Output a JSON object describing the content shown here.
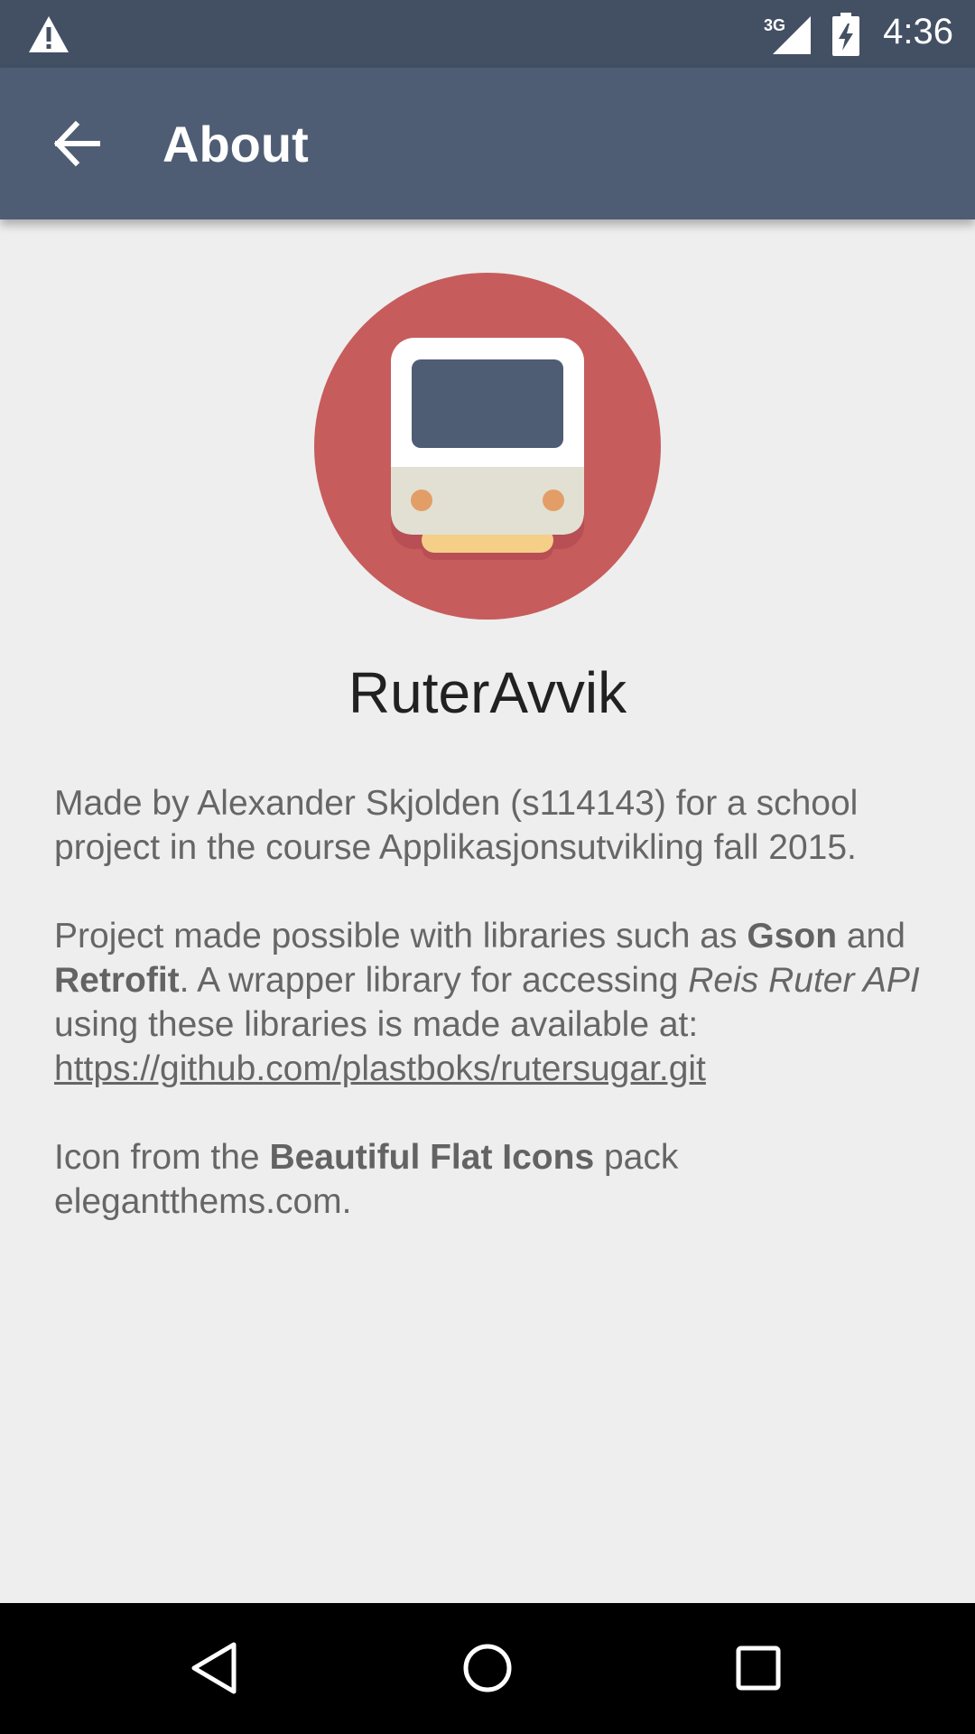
{
  "status_bar": {
    "network": "3G",
    "time": "4:36"
  },
  "app_bar": {
    "title": "About"
  },
  "app": {
    "name": "RuterAvvik"
  },
  "about": {
    "p1": " Made by Alexander Skjolden (s114143) for a school project in the course Applikasjonsutvikling fall 2015.",
    "p2_a": "Project made possible with libraries such as ",
    "p2_b": "Gson",
    "p2_c": " and ",
    "p2_d": "Retrofit",
    "p2_e": ". A wrapper library for accessing ",
    "p2_f": "Reis Ruter API",
    "p2_g": " using these libraries is made available at: ",
    "p2_link": "https://github.com/plastboks/rutersugar.git",
    "p3_a": "Icon from the ",
    "p3_b": "Beautiful Flat Icons",
    "p3_c": " pack elegantthems.com."
  },
  "icons": {
    "warning": "warning-icon",
    "signal": "signal-3g-icon",
    "battery": "battery-charging-icon",
    "back": "arrow-back-icon",
    "logo": "train-logo-icon",
    "nav_back": "nav-back-icon",
    "nav_home": "nav-home-icon",
    "nav_recents": "nav-recents-icon"
  }
}
